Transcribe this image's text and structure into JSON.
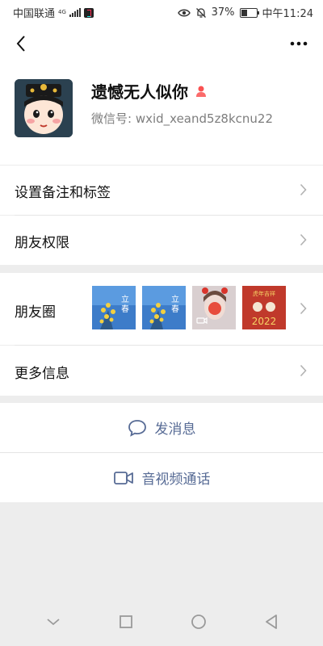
{
  "status_bar": {
    "carrier": "中国联通",
    "network": "4G",
    "battery": "37%",
    "battery_level": 0.37,
    "time": "中午11:24"
  },
  "nav": {
    "back_icon": "chevron-left-icon",
    "more_icon": "more-dots-icon"
  },
  "profile": {
    "name": "遗憾无人似你",
    "wechat_id": "微信号: wxid_xeand5z8kcnu22",
    "gender_icon": "female-person-icon",
    "gender_color": "#fa5151"
  },
  "rows": {
    "remark_tags": "设置备注和标签",
    "friend_permissions": "朋友权限",
    "moments": "朋友圈",
    "more_info": "更多信息"
  },
  "moments_thumbs": {
    "badge_text": "2022",
    "caption": "虎年吉祥"
  },
  "actions": {
    "send_message": "发消息",
    "video_call": "音视频通话",
    "accent": "#576b95"
  }
}
